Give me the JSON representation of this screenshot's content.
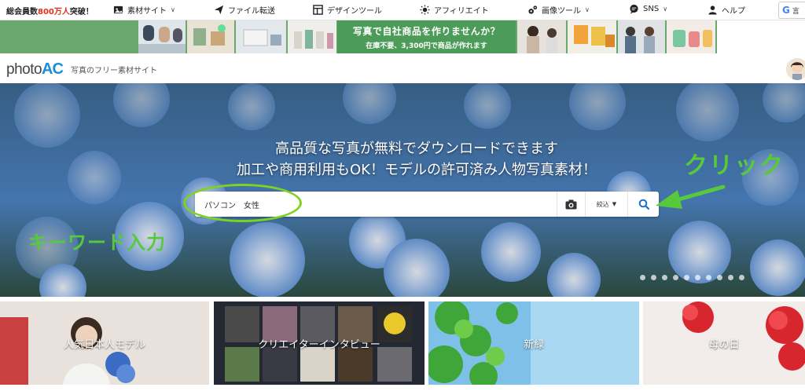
{
  "topnav": {
    "members_prefix": "総会員数",
    "members_count": "800万人",
    "members_suffix": "突破！",
    "items": [
      {
        "label": "素材サイト",
        "icon": "image-icon",
        "has_dropdown": true
      },
      {
        "label": "ファイル転送",
        "icon": "paper-plane-icon",
        "has_dropdown": false
      },
      {
        "label": "デザインツール",
        "icon": "layout-icon",
        "has_dropdown": false
      },
      {
        "label": "アフィリエイト",
        "icon": "sun-icon",
        "has_dropdown": false
      },
      {
        "label": "画像ツール",
        "icon": "gears-icon",
        "has_dropdown": true
      },
      {
        "label": "SNS",
        "icon": "chat-icon",
        "has_dropdown": true
      },
      {
        "label": "ヘルプ",
        "icon": "person-icon",
        "has_dropdown": false
      }
    ],
    "language_label": "言"
  },
  "banner": {
    "line1": "写真で自社商品を作りませんか？",
    "line2": "在庫不要、3,300円で商品が作れます"
  },
  "logobar": {
    "logo_photo": "photo",
    "logo_ac": "AC",
    "tagline": "写真のフリー素材サイト"
  },
  "hero": {
    "title1": "高品質な写真が無料でダウンロードできます",
    "title2": "加工や商用利用もOK！モデルの許可済み人物写真素材！",
    "search_value": "パソコン　女性",
    "filter_label": "絞込",
    "annotation_click": "クリック",
    "annotation_keyword": "キーワード入力",
    "slide_count": 10
  },
  "tiles": [
    {
      "label": "人気日本人モデル"
    },
    {
      "label": "クリエイターインタビュー"
    },
    {
      "label": "新緑"
    },
    {
      "label": "母の日"
    }
  ],
  "colors": {
    "brand_blue": "#1a8fd8",
    "annotation_green": "#59c93c",
    "banner_green": "#4d9b58",
    "members_red": "#e0301e"
  }
}
